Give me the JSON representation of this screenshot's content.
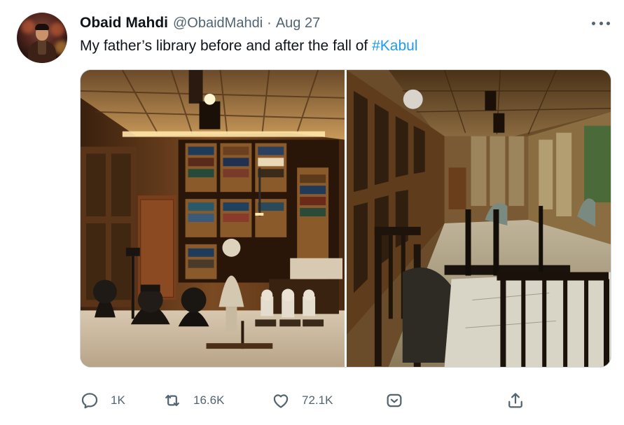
{
  "tweet": {
    "author_name": "Obaid Mahdi",
    "handle": "@ObaidMahdi",
    "separator": "·",
    "date": "Aug 27",
    "text_prefix": "My father’s library before and after the fall of ",
    "hashtag": "#Kabul"
  },
  "actions": {
    "replies": "1K",
    "retweets": "16.6K",
    "likes": "72.1K"
  },
  "icons": [
    "more-icon",
    "reply-icon",
    "retweet-icon",
    "like-icon",
    "tip-icon",
    "share-icon"
  ],
  "colors": {
    "accent": "#1d9bf0",
    "secondary_text": "#536471",
    "primary_text": "#0f1419"
  }
}
